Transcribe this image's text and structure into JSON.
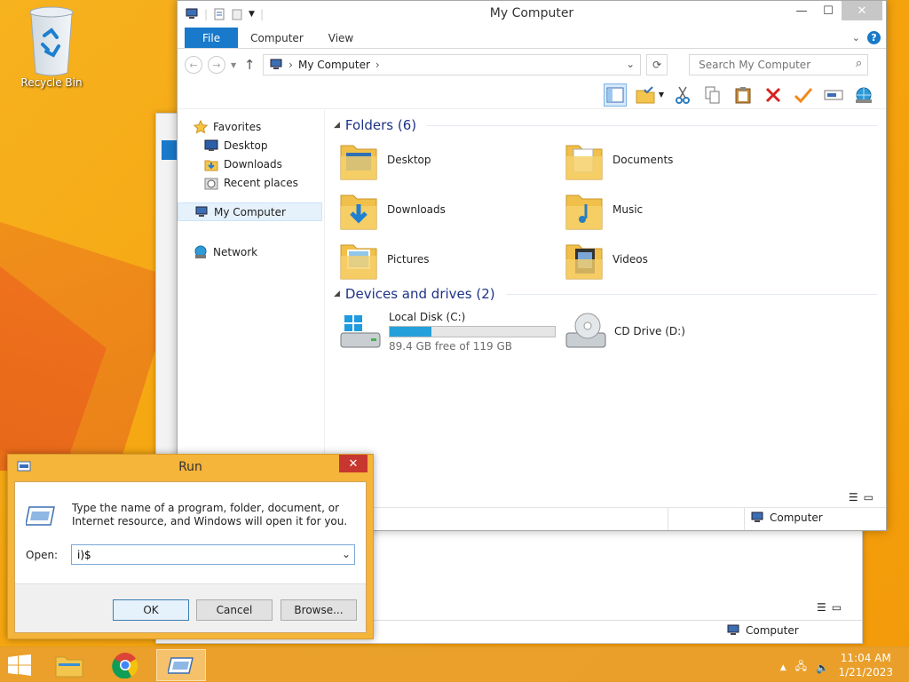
{
  "desktop": {
    "recycle_bin_label": "Recycle Bin"
  },
  "explorer": {
    "title": "My Computer",
    "tabs": [
      "File",
      "Computer",
      "View"
    ],
    "address": "My Computer",
    "search_placeholder": "Search My Computer",
    "nav": {
      "favorites": "Favorites",
      "favorites_items": [
        "Desktop",
        "Downloads",
        "Recent places"
      ],
      "my_computer": "My Computer",
      "network": "Network"
    },
    "folders_header": "Folders (6)",
    "folders": [
      "Desktop",
      "Documents",
      "Downloads",
      "Music",
      "Pictures",
      "Videos"
    ],
    "devices_header": "Devices and drives (2)",
    "drives": {
      "c_name": "Local Disk (C:)",
      "c_free": "89.4 GB free of 119 GB",
      "c_used_fraction": 0.25,
      "d_name": "CD Drive (D:)"
    },
    "status_computer": "Computer"
  },
  "bg_window": {
    "status_computer": "Computer"
  },
  "run_dialog": {
    "title": "Run",
    "description": "Type the name of a program, folder, document, or Internet resource, and Windows will open it for you.",
    "open_label": "Open:",
    "open_value": "i)$",
    "ok": "OK",
    "cancel": "Cancel",
    "browse": "Browse..."
  },
  "taskbar": {
    "time": "11:04 AM",
    "date": "1/21/2023"
  },
  "colors": {
    "accent": "#1979ca",
    "progress": "#26a0da",
    "taskbar": "#e8a02e"
  }
}
